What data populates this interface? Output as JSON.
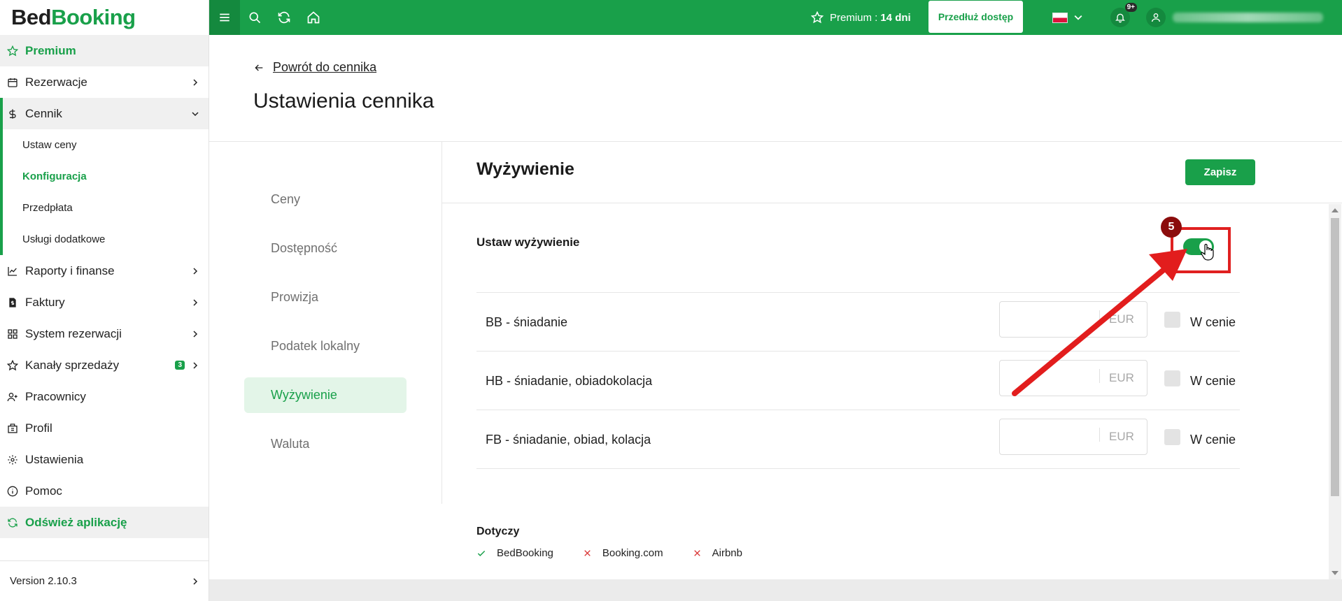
{
  "brand": {
    "part1": "Bed",
    "part2": "Booking"
  },
  "sidebar": {
    "premium": "Premium",
    "items": [
      {
        "label": "Rezerwacje",
        "icon": "calendar-icon"
      },
      {
        "label": "Cennik",
        "icon": "dollar-icon"
      }
    ],
    "cennik_sub": [
      "Ustaw ceny",
      "Konfiguracja",
      "Przedpłata",
      "Usługi dodatkowe"
    ],
    "items2": [
      {
        "label": "Raporty i finanse"
      },
      {
        "label": "Faktury"
      },
      {
        "label": "System rezerwacji"
      },
      {
        "label": "Kanały sprzedaży",
        "badge": "3"
      },
      {
        "label": "Pracownicy"
      },
      {
        "label": "Profil"
      },
      {
        "label": "Ustawienia"
      },
      {
        "label": "Pomoc"
      }
    ],
    "refresh": "Odśwież aplikację",
    "version": "Version 2.10.3"
  },
  "topbar": {
    "premium_label": "Premium :",
    "premium_days": "14 dni",
    "extend_label": "Przedłuż dostęp",
    "notifications_badge": "9+",
    "accent": "#19a04a"
  },
  "page": {
    "back_link": "Powrót do cennika",
    "title": "Ustawienia cennika"
  },
  "tabs": [
    "Ceny",
    "Dostępność",
    "Prowizja",
    "Podatek lokalny",
    "Wyżywienie",
    "Waluta"
  ],
  "panel": {
    "title": "Wyżywienie",
    "save_label": "Zapisz",
    "setting_label": "Ustaw wyżywienie",
    "toggle_on": true
  },
  "meals": [
    {
      "name": "BB - śniadanie",
      "value": "",
      "currency": "EUR",
      "included_label": "W cenie"
    },
    {
      "name": "HB - śniadanie, obiadokolacja",
      "value": "",
      "currency": "EUR",
      "included_label": "W cenie"
    },
    {
      "name": "FB - śniadanie, obiad, kolacja",
      "value": "",
      "currency": "EUR",
      "included_label": "W cenie"
    }
  ],
  "applies": {
    "title": "Dotyczy",
    "items": [
      {
        "label": "BedBooking",
        "status": "yes"
      },
      {
        "label": "Booking.com",
        "status": "no"
      },
      {
        "label": "Airbnb",
        "status": "no"
      }
    ]
  },
  "annotation": {
    "step": "5"
  }
}
